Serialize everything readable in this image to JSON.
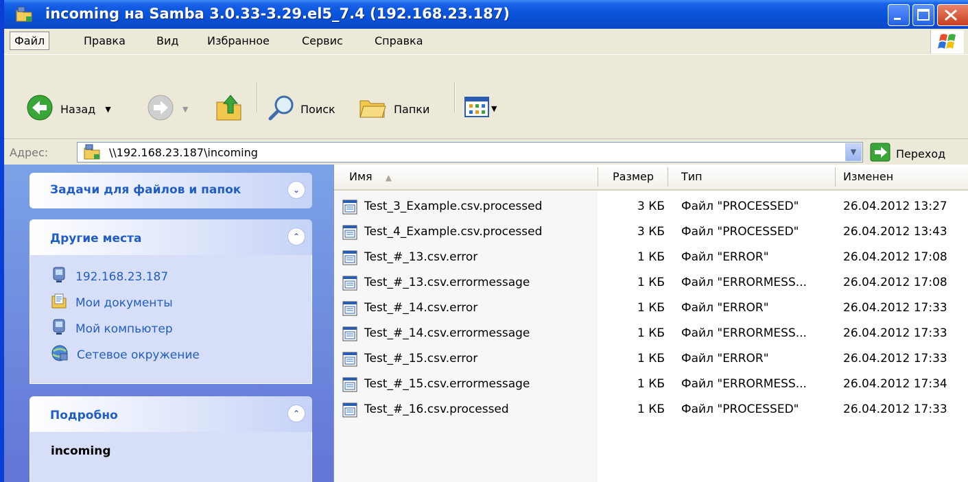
{
  "window": {
    "title": "incoming на Samba 3.0.33-3.29.el5_7.4 (192.168.23.187)"
  },
  "menu": [
    "Файл",
    "Правка",
    "Вид",
    "Избранное",
    "Сервис",
    "Справка"
  ],
  "toolbar": {
    "back_label": "Назад",
    "search_label": "Поиск",
    "folders_label": "Папки"
  },
  "address": {
    "label": "Адрес:",
    "value": "\\\\192.168.23.187\\incoming",
    "go_label": "Переход"
  },
  "left_pane": {
    "tasks_title": "Задачи для файлов и папок",
    "places_title": "Другие места",
    "places": [
      {
        "label": "192.168.23.187",
        "icon": "network-computer-icon"
      },
      {
        "label": "Мои документы",
        "icon": "my-documents-icon"
      },
      {
        "label": "Мой компьютер",
        "icon": "my-computer-icon"
      },
      {
        "label": "Сетевое окружение",
        "icon": "network-places-icon"
      }
    ],
    "details_title": "Подробно",
    "details_name": "incoming"
  },
  "columns": {
    "name": "Имя",
    "size": "Размер",
    "type": "Тип",
    "modified": "Изменен"
  },
  "files": [
    {
      "name": "Test_3_Example.csv.processed",
      "size": "3 КБ",
      "type": "Файл \"PROCESSED\"",
      "modified": "26.04.2012 13:27"
    },
    {
      "name": "Test_4_Example.csv.processed",
      "size": "3 КБ",
      "type": "Файл \"PROCESSED\"",
      "modified": "26.04.2012 13:43"
    },
    {
      "name": "Test_#_13.csv.error",
      "size": "1 КБ",
      "type": "Файл \"ERROR\"",
      "modified": "26.04.2012 17:08"
    },
    {
      "name": "Test_#_13.csv.errormessage",
      "size": "1 КБ",
      "type": "Файл \"ERRORMESS...",
      "modified": "26.04.2012 17:08"
    },
    {
      "name": "Test_#_14.csv.error",
      "size": "1 КБ",
      "type": "Файл \"ERROR\"",
      "modified": "26.04.2012 17:33"
    },
    {
      "name": "Test_#_14.csv.errormessage",
      "size": "1 КБ",
      "type": "Файл \"ERRORMESS...",
      "modified": "26.04.2012 17:33"
    },
    {
      "name": "Test_#_15.csv.error",
      "size": "1 КБ",
      "type": "Файл \"ERROR\"",
      "modified": "26.04.2012 17:33"
    },
    {
      "name": "Test_#_15.csv.errormessage",
      "size": "1 КБ",
      "type": "Файл \"ERRORMESS...",
      "modified": "26.04.2012 17:34"
    },
    {
      "name": "Test_#_16.csv.processed",
      "size": "1 КБ",
      "type": "Файл \"PROCESSED\"",
      "modified": "26.04.2012 17:33"
    }
  ]
}
